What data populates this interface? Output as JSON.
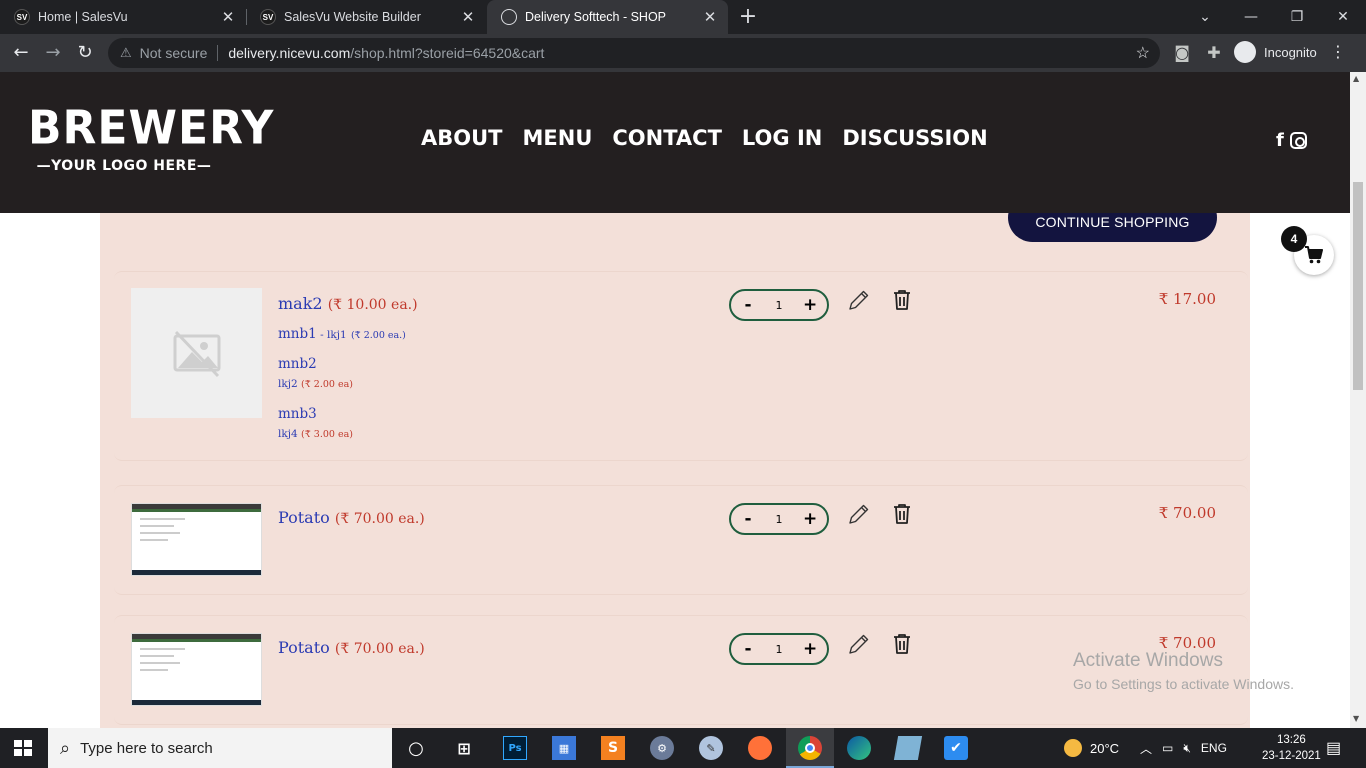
{
  "browser": {
    "tabs": [
      {
        "label": "Home | SalesVu",
        "favicon": "SV"
      },
      {
        "label": "SalesVu Website Builder",
        "favicon": "SV"
      },
      {
        "label": "Delivery Softtech - SHOP",
        "favicon": "globe-icon"
      }
    ],
    "address": {
      "security": "Not secure",
      "host": "delivery.nicevu.com",
      "path": "/shop.html?storeid=64520&cart"
    },
    "profile": "Incognito"
  },
  "site": {
    "logo_big": "BREWERY",
    "logo_small": "—YOUR LOGO HERE—",
    "nav": [
      "ABOUT",
      "MENU",
      "CONTACT",
      "LOG IN",
      "DISCUSSION"
    ],
    "social": [
      "facebook-icon",
      "instagram-icon"
    ]
  },
  "cart": {
    "continue_label": "CONTINUE SHOPPING",
    "badge_count": "4",
    "items": [
      {
        "name": "mak2",
        "unit_price": "(₹ 10.00 ea.)",
        "modifiers": [
          {
            "name": "mnb1",
            "sep": " - ",
            "option": "lkj1",
            "price": "(₹ 2.00 ea.)"
          },
          {
            "name": "mnb2",
            "option": "lkj2",
            "price": "(₹ 2.00 ea)"
          },
          {
            "name": "mnb3",
            "option": "lkj4",
            "price": "(₹ 3.00 ea)"
          }
        ],
        "qty": "1",
        "total": "₹ 17.00"
      },
      {
        "name": "Potato",
        "unit_price": "(₹ 70.00 ea.)",
        "qty": "1",
        "total": "₹ 70.00"
      },
      {
        "name": "Potato",
        "unit_price": "(₹ 70.00 ea.)",
        "qty": "1",
        "total": "₹ 70.00"
      }
    ],
    "minus": "-",
    "plus": "+"
  },
  "watermark": {
    "line1": "Activate Windows",
    "line2": "Go to Settings to activate Windows."
  },
  "taskbar": {
    "search_placeholder": "Type here to search",
    "weather": "20°C",
    "lang": "ENG",
    "time": "13:26",
    "date": "23-12-2021"
  },
  "colors": {
    "header_bg": "#231f20",
    "panel_bg": "#f3e0d9",
    "button_bg": "#13143f",
    "product_text": "#2b3bb3",
    "price_text": "#c0392b",
    "qty_border": "#1f5e3e"
  }
}
